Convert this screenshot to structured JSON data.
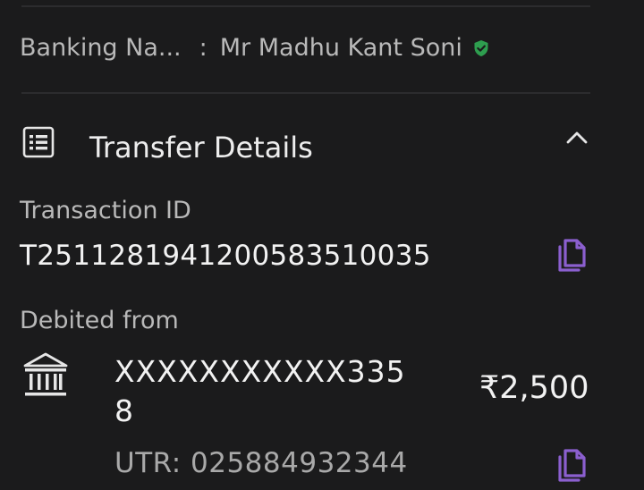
{
  "colors": {
    "background": "#1b1b1c",
    "accent": "#8b5fcf",
    "verified": "#2e9e4f"
  },
  "banking": {
    "label": "Banking Na...",
    "separator": ":",
    "value": "Mr Madhu Kant Soni",
    "verified_icon": "shield-check-icon"
  },
  "section": {
    "title": "Transfer Details",
    "icon": "receipt-list-icon",
    "toggle_icon": "chevron-up-icon"
  },
  "transaction": {
    "label": "Transaction ID",
    "value": "T2511281941200583510035"
  },
  "debit": {
    "label": "Debited from",
    "account_line1": "XXXXXXXXXXX335",
    "account_line2": "8",
    "amount": "₹2,500",
    "utr": "UTR: 025884932344",
    "bank_icon": "bank-icon"
  }
}
